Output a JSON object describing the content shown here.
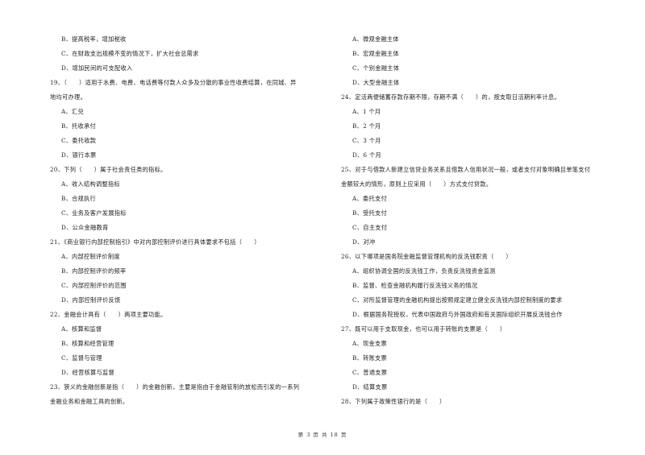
{
  "page": {
    "footer": "第 3 页 共 18 页"
  },
  "left_column": [
    {
      "type": "opt",
      "text": "B、提高税率，增加税收"
    },
    {
      "type": "opt",
      "text": "C、在财政支出规模不变的情况下，扩大社会总需求"
    },
    {
      "type": "opt",
      "text": "D、增加民间的可支配收入"
    },
    {
      "type": "q",
      "text": "19、（　　）适用于水费、电费、电话费等付款人众多及分散的事业性收费结算，在同城、异"
    },
    {
      "type": "cont",
      "text": "地均可办理。"
    },
    {
      "type": "opt",
      "text": "A、汇兑"
    },
    {
      "type": "opt",
      "text": "B、托收承付"
    },
    {
      "type": "opt",
      "text": "C、委托收款"
    },
    {
      "type": "opt",
      "text": "D、银行本票"
    },
    {
      "type": "q",
      "text": "20、下列（　　）属于社会责任类的指标。"
    },
    {
      "type": "opt",
      "text": "A、收入结构调整指标"
    },
    {
      "type": "opt",
      "text": "B、合规执行"
    },
    {
      "type": "opt",
      "text": "C、业务及客户发展指标"
    },
    {
      "type": "opt",
      "text": "D、公众金融教育"
    },
    {
      "type": "q",
      "text": "21、《商业银行内部控制指引》中对内部控制评价进行具体要求不包括（　　）"
    },
    {
      "type": "opt",
      "text": "A、内部控制评价制度"
    },
    {
      "type": "opt",
      "text": "B、内部控制评价的频率"
    },
    {
      "type": "opt",
      "text": "C、内部控制评价的范围"
    },
    {
      "type": "opt",
      "text": "D、内部控制评价反馈"
    },
    {
      "type": "q",
      "text": "22、金融会计具有（　　）两项主要功能。"
    },
    {
      "type": "opt",
      "text": "A、核算和监督"
    },
    {
      "type": "opt",
      "text": "B、核算和经营管理"
    },
    {
      "type": "opt",
      "text": "C、监督与管理"
    },
    {
      "type": "opt",
      "text": "D、经营核算与监督"
    },
    {
      "type": "q",
      "text": "23、狭义的金融创新是指（　　）的金融创新，主要是指由于金融管制的放松而引发的一系列"
    },
    {
      "type": "cont",
      "text": "金融业务和金融工具的创新。"
    }
  ],
  "right_column": [
    {
      "type": "opt",
      "text": "A、微观金融主体"
    },
    {
      "type": "opt",
      "text": "B、宏观金融主体"
    },
    {
      "type": "opt",
      "text": "C、个别金融主体"
    },
    {
      "type": "opt",
      "text": "D、大型金融主体"
    },
    {
      "type": "q",
      "text": "24、定活两便储蓄存款存期不限，存期不满（　　）的，按支取日活期利率计息。"
    },
    {
      "type": "opt",
      "text": "A、1 个月"
    },
    {
      "type": "opt",
      "text": "B、2 个月"
    },
    {
      "type": "opt",
      "text": "C、3 个月"
    },
    {
      "type": "opt",
      "text": "D、6 个月"
    },
    {
      "type": "q",
      "text": "25、对于与借款人新建立信贷业务关系且借款人信用状况一般，或者支付对象明确且单笔支付"
    },
    {
      "type": "cont",
      "text": "金额较大的情形，原则上应采用（　　）方式支付贷款。"
    },
    {
      "type": "opt",
      "text": "A、委托支付"
    },
    {
      "type": "opt",
      "text": "B、受托支付"
    },
    {
      "type": "opt",
      "text": "C、自主支付"
    },
    {
      "type": "opt",
      "text": "D、对冲"
    },
    {
      "type": "q",
      "text": "26、以下哪项是国务院金融监督管理机构的反洗钱职责（　　）"
    },
    {
      "type": "opt",
      "text": "A、组织协调全国的反洗钱工作，负责反洗钱资金监测"
    },
    {
      "type": "opt",
      "text": "B、监督、检查金融机构履行反洗钱义务的情况"
    },
    {
      "type": "opt",
      "text": "C、对所监督管理的金融机构提出按照规定建立健全反洗钱内部控制制度的要求"
    },
    {
      "type": "opt",
      "text": "D、根据国务院授权，代表中国政府与外国政府和有关国际组织开展反洗钱合作"
    },
    {
      "type": "q",
      "text": "27、既可以用于支取现金，也可以用于转账的支票是（　　）"
    },
    {
      "type": "opt",
      "text": "A、现金支票"
    },
    {
      "type": "opt",
      "text": "B、转账支票"
    },
    {
      "type": "opt",
      "text": "C、普通支票"
    },
    {
      "type": "opt",
      "text": "D、结算支票"
    },
    {
      "type": "q",
      "text": "28、下列属于政策性银行的是（　　）"
    }
  ]
}
